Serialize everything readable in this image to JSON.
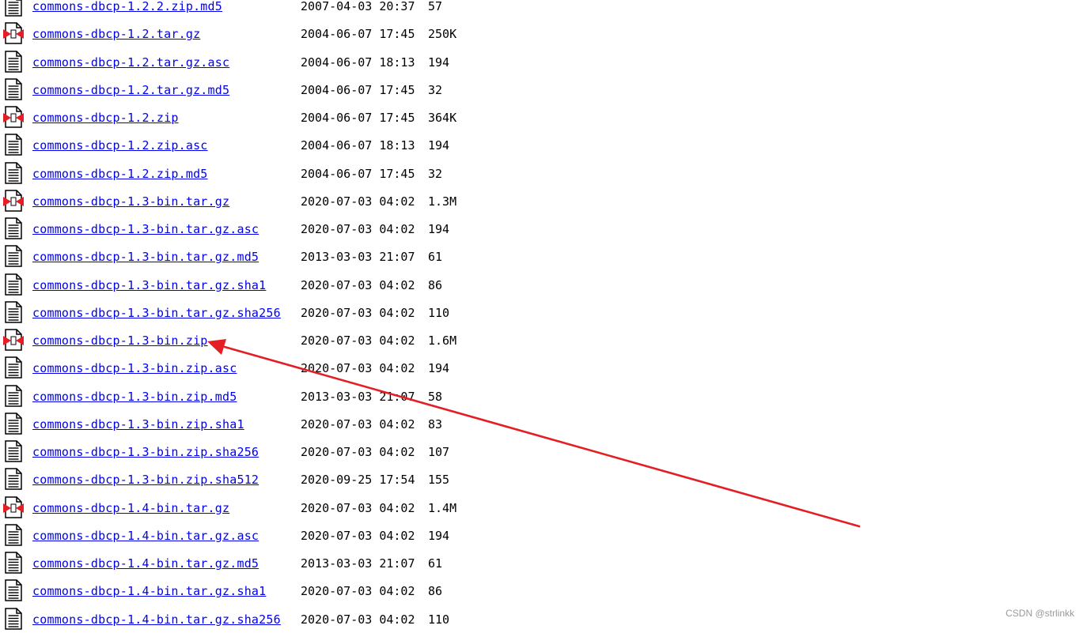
{
  "files": [
    {
      "name": "commons-dbcp-1.2.2.zip.md5",
      "date": "2007-04-03 20:37",
      "size": " 57",
      "icon": "text-file-icon"
    },
    {
      "name": "commons-dbcp-1.2.tar.gz",
      "date": "2004-06-07 17:45",
      "size": "250K",
      "icon": "archive-file-icon"
    },
    {
      "name": "commons-dbcp-1.2.tar.gz.asc",
      "date": "2004-06-07 18:13",
      "size": "194",
      "icon": "text-file-icon"
    },
    {
      "name": "commons-dbcp-1.2.tar.gz.md5",
      "date": "2004-06-07 17:45",
      "size": " 32",
      "icon": "text-file-icon"
    },
    {
      "name": "commons-dbcp-1.2.zip",
      "date": "2004-06-07 17:45",
      "size": "364K",
      "icon": "archive-file-icon"
    },
    {
      "name": "commons-dbcp-1.2.zip.asc",
      "date": "2004-06-07 18:13",
      "size": "194",
      "icon": "text-file-icon"
    },
    {
      "name": "commons-dbcp-1.2.zip.md5",
      "date": "2004-06-07 17:45",
      "size": " 32",
      "icon": "text-file-icon"
    },
    {
      "name": "commons-dbcp-1.3-bin.tar.gz",
      "date": "2020-07-03 04:02",
      "size": "1.3M",
      "icon": "archive-file-icon"
    },
    {
      "name": "commons-dbcp-1.3-bin.tar.gz.asc",
      "date": "2020-07-03 04:02",
      "size": "194",
      "icon": "text-file-icon"
    },
    {
      "name": "commons-dbcp-1.3-bin.tar.gz.md5",
      "date": "2013-03-03 21:07",
      "size": " 61",
      "icon": "text-file-icon"
    },
    {
      "name": "commons-dbcp-1.3-bin.tar.gz.sha1",
      "date": "2020-07-03 04:02",
      "size": " 86",
      "icon": "text-file-icon"
    },
    {
      "name": "commons-dbcp-1.3-bin.tar.gz.sha256",
      "date": "2020-07-03 04:02",
      "size": "110",
      "icon": "text-file-icon"
    },
    {
      "name": "commons-dbcp-1.3-bin.zip",
      "date": "2020-07-03 04:02",
      "size": "1.6M",
      "icon": "archive-file-icon"
    },
    {
      "name": "commons-dbcp-1.3-bin.zip.asc",
      "date": "2020-07-03 04:02",
      "size": "194",
      "icon": "text-file-icon"
    },
    {
      "name": "commons-dbcp-1.3-bin.zip.md5",
      "date": "2013-03-03 21:07",
      "size": " 58",
      "icon": "text-file-icon"
    },
    {
      "name": "commons-dbcp-1.3-bin.zip.sha1",
      "date": "2020-07-03 04:02",
      "size": " 83",
      "icon": "text-file-icon"
    },
    {
      "name": "commons-dbcp-1.3-bin.zip.sha256",
      "date": "2020-07-03 04:02",
      "size": "107",
      "icon": "text-file-icon"
    },
    {
      "name": "commons-dbcp-1.3-bin.zip.sha512",
      "date": "2020-09-25 17:54",
      "size": "155",
      "icon": "text-file-icon"
    },
    {
      "name": "commons-dbcp-1.4-bin.tar.gz",
      "date": "2020-07-03 04:02",
      "size": "1.4M",
      "icon": "archive-file-icon"
    },
    {
      "name": "commons-dbcp-1.4-bin.tar.gz.asc",
      "date": "2020-07-03 04:02",
      "size": "194",
      "icon": "text-file-icon"
    },
    {
      "name": "commons-dbcp-1.4-bin.tar.gz.md5",
      "date": "2013-03-03 21:07",
      "size": " 61",
      "icon": "text-file-icon"
    },
    {
      "name": "commons-dbcp-1.4-bin.tar.gz.sha1",
      "date": "2020-07-03 04:02",
      "size": " 86",
      "icon": "text-file-icon"
    },
    {
      "name": "commons-dbcp-1.4-bin.tar.gz.sha256",
      "date": "2020-07-03 04:02",
      "size": "110",
      "icon": "text-file-icon"
    }
  ],
  "annotation": {
    "target": "commons-dbcp-1.3-bin.zip",
    "color": "#e31e24"
  },
  "watermark": "CSDN @strlinkk",
  "colors": {
    "link": "#0000ee",
    "archive_icon_accent": "#e31e24"
  }
}
